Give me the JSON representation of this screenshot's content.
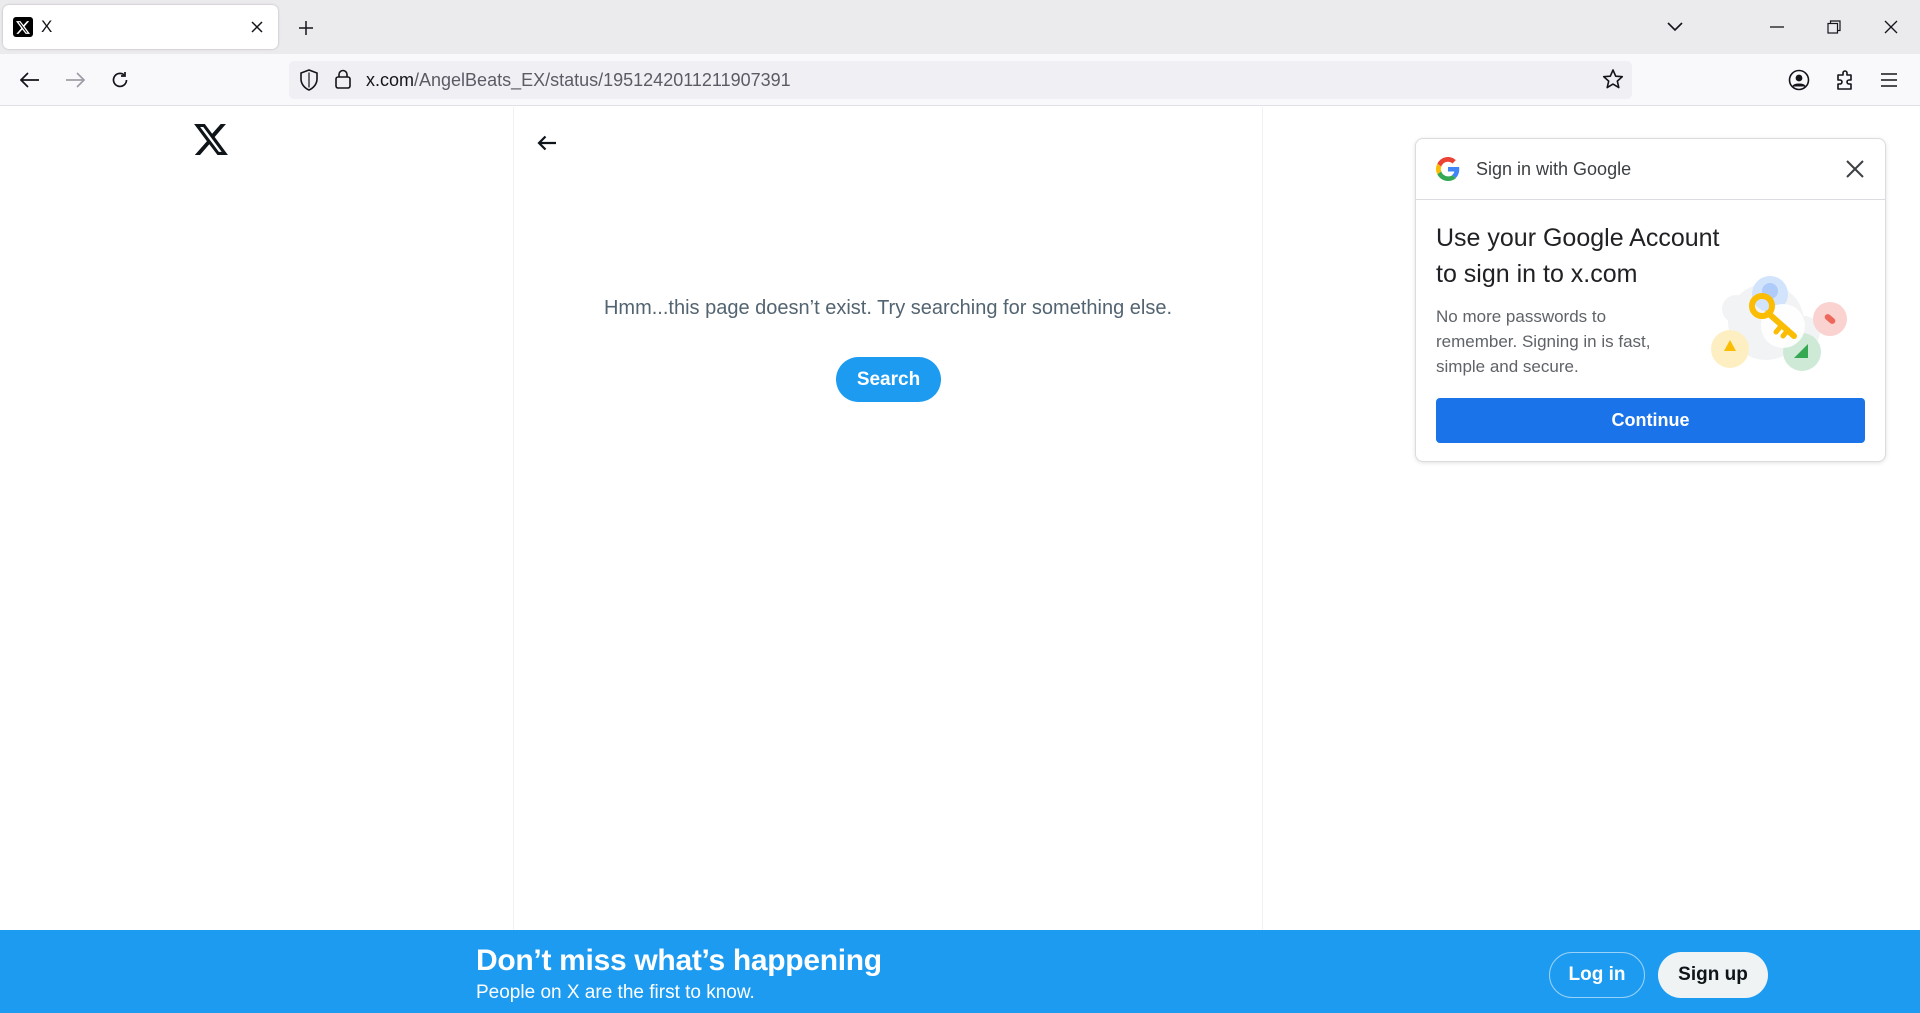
{
  "browser": {
    "tab": {
      "title": "X",
      "favicon": "x-logo-icon"
    },
    "url": {
      "host": "x.com",
      "path": "/AngelBeats_EX/status/1951242011211907391"
    }
  },
  "page": {
    "empty_message": "Hmm...this page doesn’t exist. Try searching for something else.",
    "search_label": "Search"
  },
  "google_popup": {
    "header_title": "Sign in with Google",
    "title": "Use your Google Account to sign in to x.com",
    "body": "No more passwords to remember. Signing in is fast, simple and secure.",
    "continue_label": "Continue"
  },
  "banner": {
    "title": "Don’t miss what’s happening",
    "subtitle": "People on X are the first to know.",
    "login_label": "Log in",
    "signup_label": "Sign up"
  },
  "colors": {
    "x_blue": "#1d9bf0",
    "google_blue": "#1a73e8",
    "muted_text": "#536471"
  }
}
